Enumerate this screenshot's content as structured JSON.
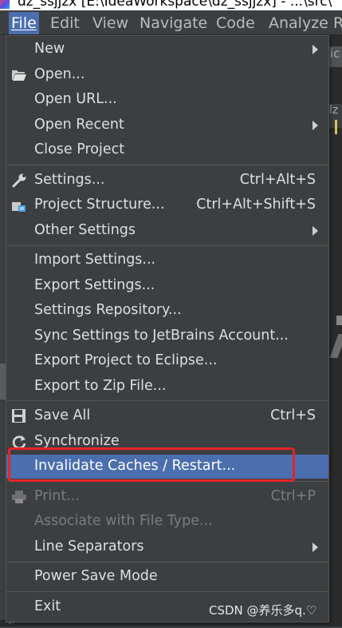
{
  "window": {
    "title": "dz_ssjjzx [E:\\IdeaWorkspace\\dz_ssjjzx] - ...\\src\\"
  },
  "menubar": {
    "items": [
      "File",
      "Edit",
      "View",
      "Navigate",
      "Code",
      "Analyze",
      "R"
    ]
  },
  "file_menu": {
    "new": "New",
    "open": "Open...",
    "open_url": "Open URL...",
    "open_recent": "Open Recent",
    "close_project": "Close Project",
    "settings": "Settings...",
    "settings_shortcut": "Ctrl+Alt+S",
    "project_structure": "Project Structure...",
    "project_structure_shortcut": "Ctrl+Alt+Shift+S",
    "other_settings": "Other Settings",
    "import_settings": "Import Settings...",
    "export_settings": "Export Settings...",
    "settings_repository": "Settings Repository...",
    "sync_settings": "Sync Settings to JetBrains Account...",
    "export_eclipse": "Export Project to Eclipse...",
    "export_zip": "Export to Zip File...",
    "save_all": "Save All",
    "save_all_shortcut": "Ctrl+S",
    "synchronize": "Synchronize",
    "invalidate_caches": "Invalidate Caches / Restart...",
    "print": "Print...",
    "print_shortcut": "Ctrl+P",
    "associate_file_type": "Associate with File Type...",
    "line_separators": "Line Separators",
    "power_save_mode": "Power Save Mode",
    "exit": "Exit"
  },
  "background": {
    "tab_fragment": "ic",
    "row_fragment": "lz",
    "bottom_fragment": "↵"
  },
  "watermark": "CSDN @养乐多q.♡",
  "colors": {
    "menu_bg": "#3c3f41",
    "highlight": "#4b6eaf",
    "annotation": "#e8232a"
  }
}
